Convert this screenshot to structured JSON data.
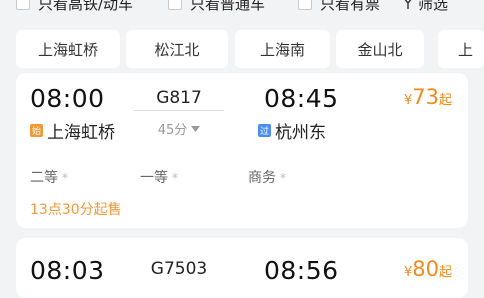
{
  "filters": {
    "high_speed_only": "只看高铁/动车",
    "normal_only": "只看普通车",
    "available_only": "只看有票",
    "screen": "筛选",
    "screen_icon": "filter-icon"
  },
  "stations": [
    "上海虹桥",
    "松江北",
    "上海南",
    "金山北",
    "上"
  ],
  "trains": [
    {
      "depart_time": "08:00",
      "depart_station": "上海虹桥",
      "depart_tag": "始",
      "train_no": "G817",
      "duration": "45分",
      "arrive_time": "08:45",
      "arrive_station": "杭州东",
      "arrive_tag": "过",
      "price_currency": "¥",
      "price": "73",
      "price_suffix": "起",
      "seats": [
        "二等",
        "一等",
        "商务"
      ],
      "seat_mark": "*",
      "sale_note": "13点30分起售"
    },
    {
      "depart_time": "08:03",
      "train_no": "G7503",
      "arrive_time": "08:56",
      "price_currency": "¥",
      "price": "80",
      "price_suffix": "起"
    }
  ],
  "colors": {
    "accent": "#f08a1d",
    "start_tag": "#f29838",
    "pass_tag": "#4a8ef0",
    "background": "#f2f3f5"
  }
}
